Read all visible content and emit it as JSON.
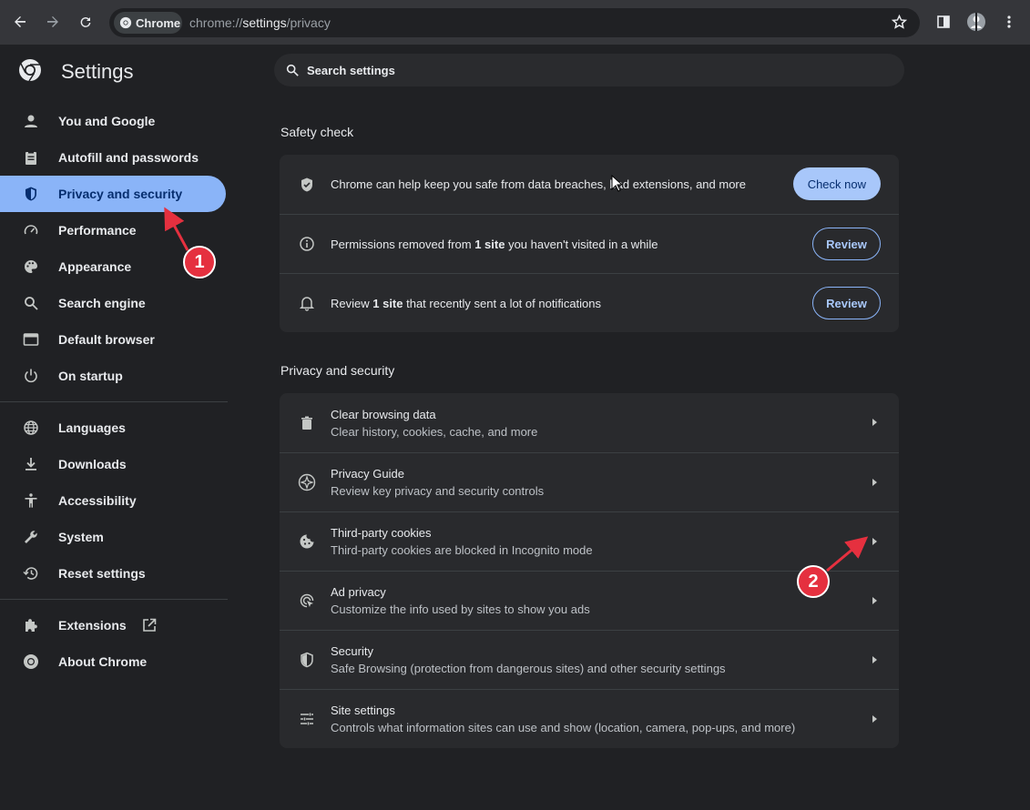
{
  "browser": {
    "chip_label": "Chrome",
    "url_scheme": "chrome://",
    "url_host": "settings",
    "url_path": "/privacy"
  },
  "sidebar": {
    "title": "Settings",
    "items": [
      {
        "label": "You and Google",
        "icon": "person-icon"
      },
      {
        "label": "Autofill and passwords",
        "icon": "clipboard-icon"
      },
      {
        "label": "Privacy and security",
        "icon": "shield-icon",
        "active": true
      },
      {
        "label": "Performance",
        "icon": "speedometer-icon"
      },
      {
        "label": "Appearance",
        "icon": "palette-icon"
      },
      {
        "label": "Search engine",
        "icon": "search-icon"
      },
      {
        "label": "Default browser",
        "icon": "browser-icon"
      },
      {
        "label": "On startup",
        "icon": "power-icon"
      },
      {
        "label": "Languages",
        "icon": "globe-icon"
      },
      {
        "label": "Downloads",
        "icon": "download-icon"
      },
      {
        "label": "Accessibility",
        "icon": "accessibility-icon"
      },
      {
        "label": "System",
        "icon": "wrench-icon"
      },
      {
        "label": "Reset settings",
        "icon": "history-icon"
      },
      {
        "label": "Extensions",
        "icon": "puzzle-icon"
      },
      {
        "label": "About Chrome",
        "icon": "chrome-icon"
      }
    ]
  },
  "search": {
    "placeholder": "Search settings"
  },
  "safety_check": {
    "title": "Safety check",
    "main_text": "Chrome can help keep you safe from data breaches, bad extensions, and more",
    "check_now": "Check now",
    "permissions_pre": "Permissions removed from ",
    "permissions_bold": "1 site",
    "permissions_post": " you haven't visited in a while",
    "notifications_pre": "Review ",
    "notifications_bold": "1 site",
    "notifications_post": " that recently sent a lot of notifications",
    "review": "Review"
  },
  "privacy": {
    "title": "Privacy and security",
    "rows": [
      {
        "title": "Clear browsing data",
        "subtitle": "Clear history, cookies, cache, and more",
        "icon": "trash-icon"
      },
      {
        "title": "Privacy Guide",
        "subtitle": "Review key privacy and security controls",
        "icon": "compass-icon"
      },
      {
        "title": "Third-party cookies",
        "subtitle": "Third-party cookies are blocked in Incognito mode",
        "icon": "cookie-icon"
      },
      {
        "title": "Ad privacy",
        "subtitle": "Customize the info used by sites to show you ads",
        "icon": "ad-privacy-icon"
      },
      {
        "title": "Security",
        "subtitle": "Safe Browsing (protection from dangerous sites) and other security settings",
        "icon": "shield-icon"
      },
      {
        "title": "Site settings",
        "subtitle": "Controls what information sites can use and show (location, camera, pop-ups, and more)",
        "icon": "tune-icon"
      }
    ]
  },
  "annotations": {
    "badge1": "1",
    "badge2": "2",
    "color": "#e5303f"
  }
}
